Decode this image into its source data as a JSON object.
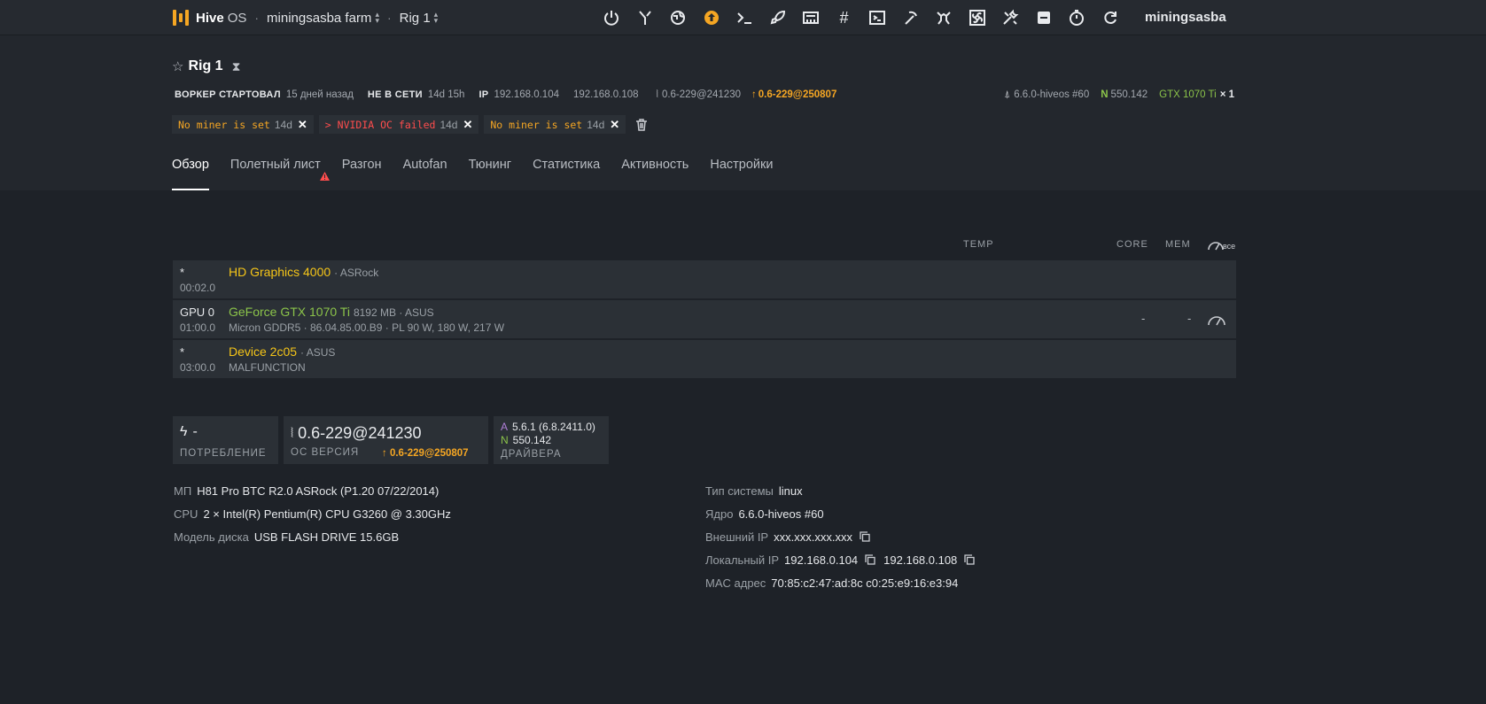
{
  "topbar": {
    "brand": "Hive",
    "brand_os": "OS",
    "farm": "miningsasba farm",
    "rig": "Rig 1",
    "user": "miningsasba",
    "accent": "#f5a623"
  },
  "rig": {
    "name": "Rig 1",
    "meta": {
      "worker_started_label": "ВОРКЕР СТАРТОВАЛ",
      "worker_started_value": "15 дней назад",
      "offline_label": "НЕ В СЕТИ",
      "offline_value": "14d 15h",
      "ip_label": "IP",
      "ip1": "192.168.0.104",
      "ip2": "192.168.0.108",
      "version": "0.6-229@241230",
      "version_update": "0.6-229@250807",
      "kernel": "6.6.0-hiveos #60",
      "nv_letter": "N",
      "nv_driver": "550.142",
      "gpu_model": "GTX 1070 Ti",
      "gpu_count": "× 1"
    },
    "alerts": [
      {
        "prefix": "",
        "text": "No miner is set",
        "age": "14d",
        "type": "warn"
      },
      {
        "prefix": "> ",
        "text": "NVIDIA OC failed",
        "age": "14d",
        "type": "err"
      },
      {
        "prefix": "",
        "text": "No miner is set",
        "age": "14d",
        "type": "warn"
      }
    ]
  },
  "tabs": [
    "Обзор",
    "Полетный лист",
    "Разгон",
    "Autofan",
    "Тюнинг",
    "Статистика",
    "Активность",
    "Настройки"
  ],
  "gpu_table": {
    "headers": {
      "temp": "TEMP",
      "core": "CORE",
      "mem": "MEM",
      "all": "все"
    },
    "rows": [
      {
        "id": "*",
        "bus": "00:02.0",
        "name": "HD Graphics 4000",
        "sub": "· ASRock",
        "detail": "",
        "color": "yellow"
      },
      {
        "id": "GPU 0",
        "bus": "01:00.0",
        "name": "GeForce GTX 1070 Ti",
        "sub": "8192 MB · ASUS",
        "detail": "Micron GDDR5 · 86.04.85.00.B9 · PL 90 W, 180 W, 217 W",
        "color": "green",
        "core": "-",
        "mem": "-"
      },
      {
        "id": "*",
        "bus": "03:00.0",
        "name": "Device 2c05",
        "sub": "· ASUS",
        "detail": "MALFUNCTION",
        "color": "yellow"
      }
    ]
  },
  "cards": {
    "power_value": "-",
    "power_label": "ПОТРЕБЛЕНИЕ",
    "os_version": "0.6-229@241230",
    "os_label": "ОС ВЕРСИЯ",
    "os_update": "0.6-229@250807",
    "amd_letter": "A",
    "amd_driver": "5.6.1 (6.8.2411.0)",
    "nv_letter": "N",
    "nv_driver": "550.142",
    "drivers_label": "ДРАЙВЕРА"
  },
  "info_left": [
    {
      "k": "МП",
      "v": "H81 Pro BTC R2.0 ASRock (P1.20 07/22/2014)"
    },
    {
      "k": "CPU",
      "v": "2 × Intel(R) Pentium(R) CPU G3260 @ 3.30GHz"
    },
    {
      "k": "Модель диска",
      "v": "USB FLASH DRIVE 15.6GB"
    }
  ],
  "info_right": {
    "os_type_k": "Тип системы",
    "os_type_v": "linux",
    "kernel_k": "Ядро",
    "kernel_v": "6.6.0-hiveos #60",
    "ext_ip_k": "Внешний IP",
    "ext_ip_v": "xxx.xxx.xxx.xxx",
    "local_ip_k": "Локальный IP",
    "local_ip_v1": "192.168.0.104",
    "local_ip_v2": "192.168.0.108",
    "mac_k": "MAC адрес",
    "mac_v": "70:85:c2:47:ad:8c c0:25:e9:16:e3:94"
  }
}
